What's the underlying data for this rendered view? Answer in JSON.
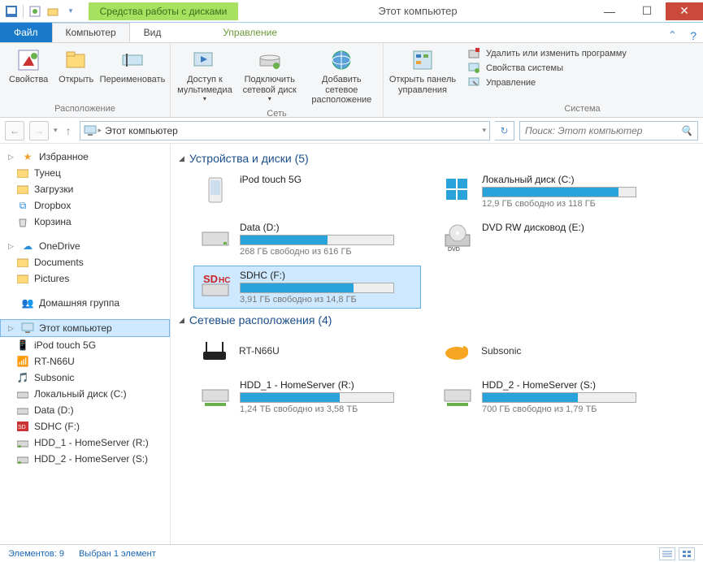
{
  "window": {
    "contextTab": "Средства работы с дисками",
    "title": "Этот компьютер"
  },
  "tabs": {
    "file": "Файл",
    "computer": "Компьютер",
    "view": "Вид",
    "manage": "Управление"
  },
  "ribbon": {
    "location": {
      "properties": "Свойства",
      "open": "Открыть",
      "rename": "Переименовать",
      "groupLabel": "Расположение"
    },
    "network": {
      "media": "Доступ к мультимедиа",
      "mapDrive": "Подключить сетевой диск",
      "addLocation": "Добавить сетевое расположение",
      "groupLabel": "Сеть"
    },
    "control": {
      "openPanel": "Открыть панель управления",
      "groupLabel": ""
    },
    "system": {
      "uninstall": "Удалить или изменить программу",
      "props": "Свойства системы",
      "manage": "Управление",
      "groupLabel": "Система"
    }
  },
  "breadcrumb": {
    "segment": "Этот компьютер"
  },
  "search": {
    "placeholder": "Поиск: Этот компьютер"
  },
  "sidebar": {
    "favorites": "Избранное",
    "favItems": [
      "Тунец",
      "Загрузки",
      "Dropbox",
      "Корзина"
    ],
    "onedrive": "OneDrive",
    "odItems": [
      "Documents",
      "Pictures"
    ],
    "homegroup": "Домашняя группа",
    "thispc": "Этот компьютер",
    "pcItems": [
      "iPod touch 5G",
      "RT-N66U",
      "Subsonic",
      "Локальный диск (C:)",
      "Data (D:)",
      "SDHC (F:)",
      "HDD_1 - HomeServer (R:)",
      "HDD_2 - HomeServer (S:)"
    ]
  },
  "sections": {
    "devices": {
      "title": "Устройства и диски (5)"
    },
    "network": {
      "title": "Сетевые расположения (4)"
    }
  },
  "drives": [
    {
      "name": "iPod touch 5G",
      "bar": false
    },
    {
      "name": "Локальный диск (C:)",
      "free": "12,9 ГБ свободно из 118 ГБ",
      "pct": 89
    },
    {
      "name": "Data (D:)",
      "free": "268 ГБ свободно из 616 ГБ",
      "pct": 57
    },
    {
      "name": "DVD RW дисковод (E:)",
      "bar": false
    },
    {
      "name": "SDHC (F:)",
      "free": "3,91 ГБ свободно из 14,8 ГБ",
      "pct": 74,
      "selected": true
    }
  ],
  "netlocs": [
    {
      "name": "RT-N66U",
      "bar": false
    },
    {
      "name": "Subsonic",
      "bar": false
    },
    {
      "name": "HDD_1 - HomeServer (R:)",
      "free": "1,24 ТБ свободно из 3,58 ТБ",
      "pct": 65
    },
    {
      "name": "HDD_2 - HomeServer (S:)",
      "free": "700 ГБ свободно из 1,79 ТБ",
      "pct": 62
    }
  ],
  "status": {
    "count": "Элементов: 9",
    "selected": "Выбран 1 элемент"
  }
}
